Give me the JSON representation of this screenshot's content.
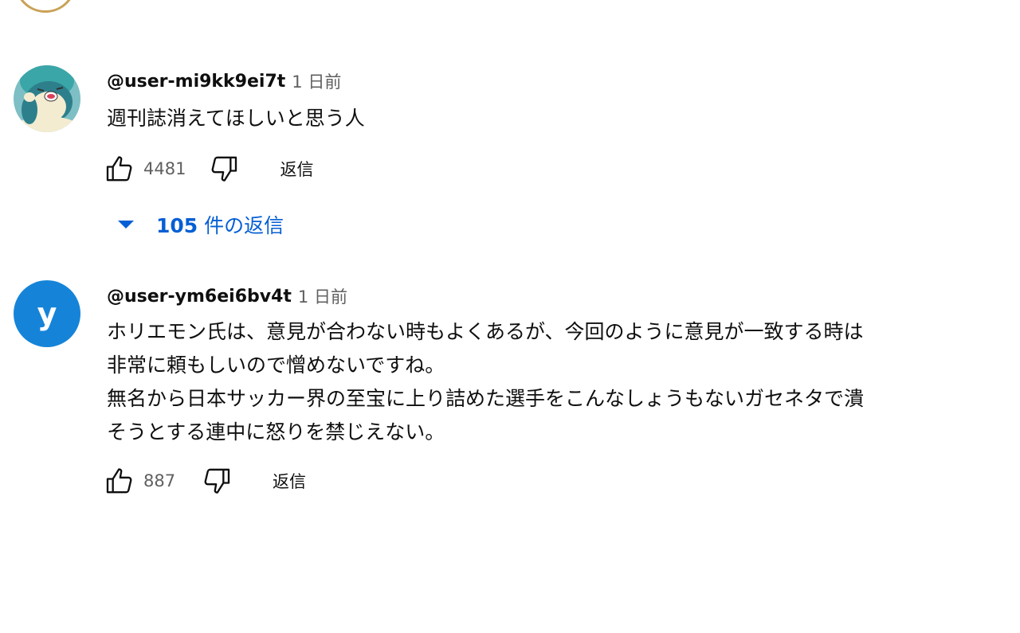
{
  "comments": [
    {
      "author": "@user-mi9kk9ei7t",
      "time": "1 日前",
      "text": "週刊誌消えてほしいと思う人",
      "likes": "4481",
      "reply_label": "返信",
      "replies": {
        "count": "105",
        "label": " 件の返信"
      }
    },
    {
      "author": "@user-ym6ei6bv4t",
      "time": "1 日前",
      "avatar_letter": "y",
      "text": "ホリエモン氏は、意見が合わない時もよくあるが、今回のように意見が一致する時は\n非常に頼もしいので憎めないですね。\n無名から日本サッカー界の至宝に上り詰めた選手をこんなしょうもないガセネタで潰\nそうとする連中に怒りを禁じえない。",
      "likes": "887",
      "reply_label": "返信"
    }
  ],
  "colors": {
    "link": "#065fd4",
    "avatar_blue": "#1584d8",
    "secondary_text": "#606060"
  },
  "icons": {
    "like": "thumbs-up-icon",
    "dislike": "thumbs-down-icon",
    "expand": "caret-down-icon"
  }
}
